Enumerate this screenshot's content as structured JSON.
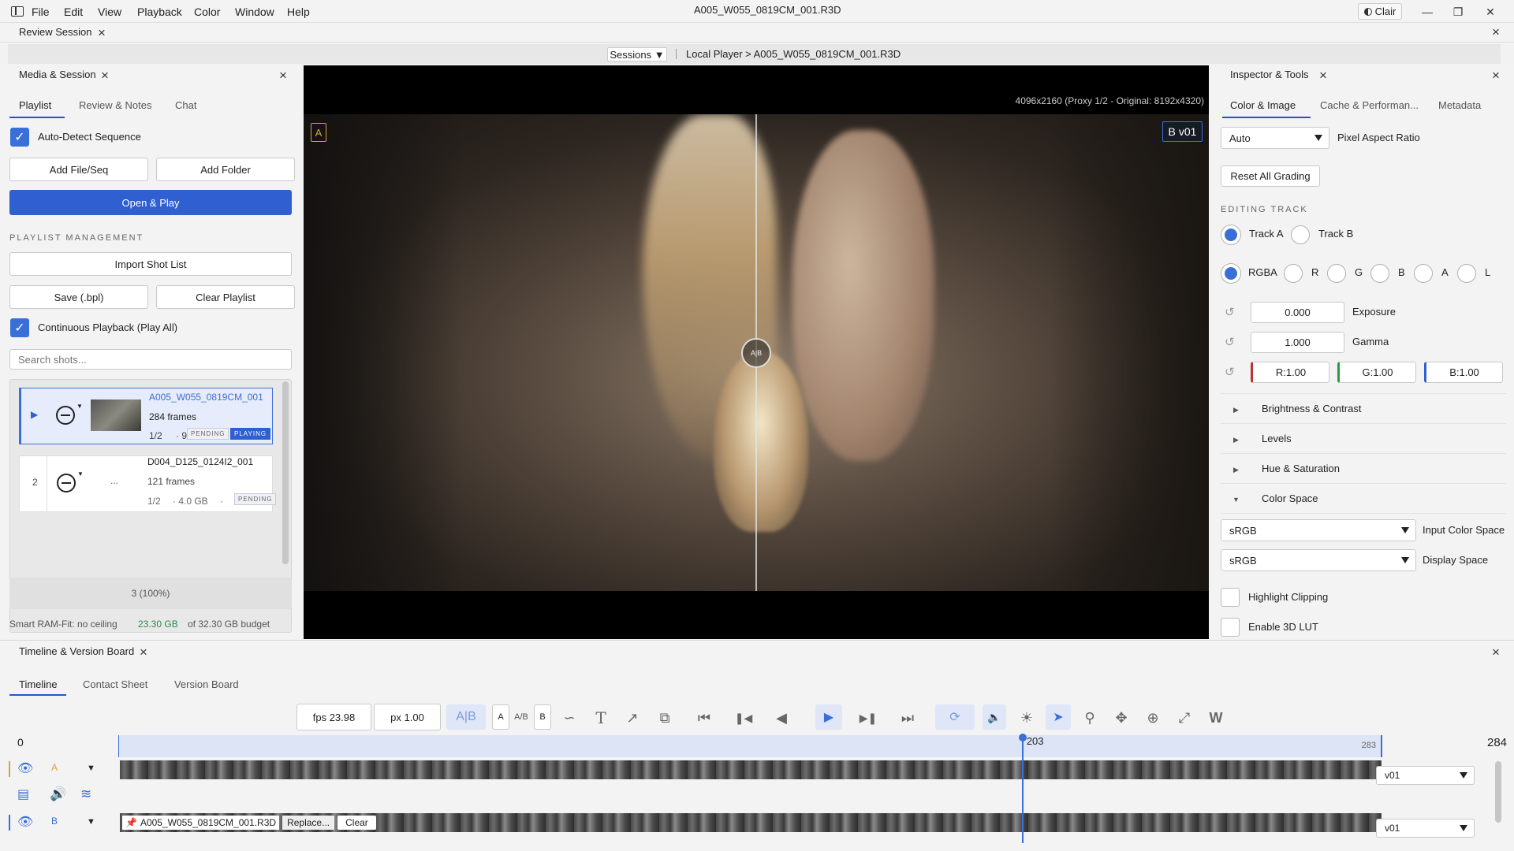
{
  "app": {
    "window_title": "A005_W055_0819CM_001.R3D",
    "theme_label": "Clair",
    "menu": [
      "File",
      "Edit",
      "View",
      "Playback",
      "Color",
      "Window",
      "Help"
    ]
  },
  "session": {
    "tab_label": "Review Session",
    "sessions_label": "Sessions ▼",
    "breadcrumb": "Local Player > A005_W055_0819CM_001.R3D"
  },
  "left_panel": {
    "title": "Media & Session",
    "tabs": [
      "Playlist",
      "Review & Notes",
      "Chat"
    ],
    "auto_detect_label": "Auto-Detect Sequence",
    "add_file_label": "Add File/Seq",
    "add_folder_label": "Add Folder",
    "open_play_label": "Open & Play",
    "playlist_management_label": "PLAYLIST MANAGEMENT",
    "import_shot_list_label": "Import Shot List",
    "save_label": "Save (.bpl)",
    "clear_playlist_label": "Clear Playlist",
    "continuous_label": "Continuous Playback (Play All)",
    "search_placeholder": "Search shots...",
    "items": [
      {
        "index": "▶",
        "name": "A005_W055_0819CM_001",
        "frames": "284 frames",
        "meta_a": "1/2",
        "meta_b": "· 9.",
        "badge1": "PENDING",
        "badge2": "PLAYING"
      },
      {
        "index": "2",
        "name": "D004_D125_0124I2_001",
        "frames": "121 frames",
        "meta_a": "1/2",
        "meta_b": "· 4.0 GB",
        "meta_c": "·",
        "thumb": "...",
        "badge1": "PENDING"
      }
    ],
    "progress_label": "3 (100%)",
    "ram_label": "Smart RAM-Fit: no ceiling",
    "ram_used": "23.30 GB",
    "ram_budget": "of 32.30 GB budget"
  },
  "viewer": {
    "resolution_label": "4096x2160 (Proxy 1/2 - Original: 8192x4320)",
    "a_label": "A",
    "b_label": "B",
    "b_version": "v01",
    "ab_label": "A|B"
  },
  "inspector": {
    "title": "Inspector & Tools",
    "tabs": [
      "Color & Image",
      "Cache & Performan...",
      "Metadata"
    ],
    "par_value": "Auto",
    "par_label": "Pixel Aspect Ratio",
    "reset_label": "Reset All Grading",
    "editing_track_label": "EDITING TRACK",
    "track_a": "Track A",
    "track_b": "Track B",
    "channels": [
      "RGBA",
      "R",
      "G",
      "B",
      "A",
      "L"
    ],
    "exposure_value": "0.000",
    "exposure_label": "Exposure",
    "gamma_value": "1.000",
    "gamma_label": "Gamma",
    "r_value": "R:1.00",
    "g_value": "G:1.00",
    "b_value": "B:1.00",
    "sections": [
      "Brightness & Contrast",
      "Levels",
      "Hue & Saturation",
      "Color Space"
    ],
    "input_cs_value": "sRGB",
    "input_cs_label": "Input Color Space",
    "display_cs_value": "sRGB",
    "display_cs_label": "Display Space",
    "highlight_label": "Highlight Clipping",
    "lut_label": "Enable 3D LUT"
  },
  "timeline": {
    "title": "Timeline & Version Board",
    "tabs": [
      "Timeline",
      "Contact Sheet",
      "Version Board"
    ],
    "fps_label": "fps 23.98",
    "px_label": "px 1.00",
    "ab_mode": "A|B",
    "a_btn": "A",
    "ab_btn": "A/B",
    "b_btn": "B",
    "start_frame": "0",
    "playhead_frame": "203",
    "end_marker": "283",
    "total_frames": "284",
    "track_a_label": "A",
    "track_b_label": "B",
    "track_a_version": "v01",
    "track_b_version": "v01",
    "clip_name": "A005_W055_0819CM_001.R3D",
    "replace_label": "Replace...",
    "clear_label": "Clear",
    "playhead_fraction": 0.7148
  },
  "colors": {
    "accent": "#2f5fd0",
    "ram_used": "#2a8a50",
    "badge_a": "#d8a43a"
  }
}
